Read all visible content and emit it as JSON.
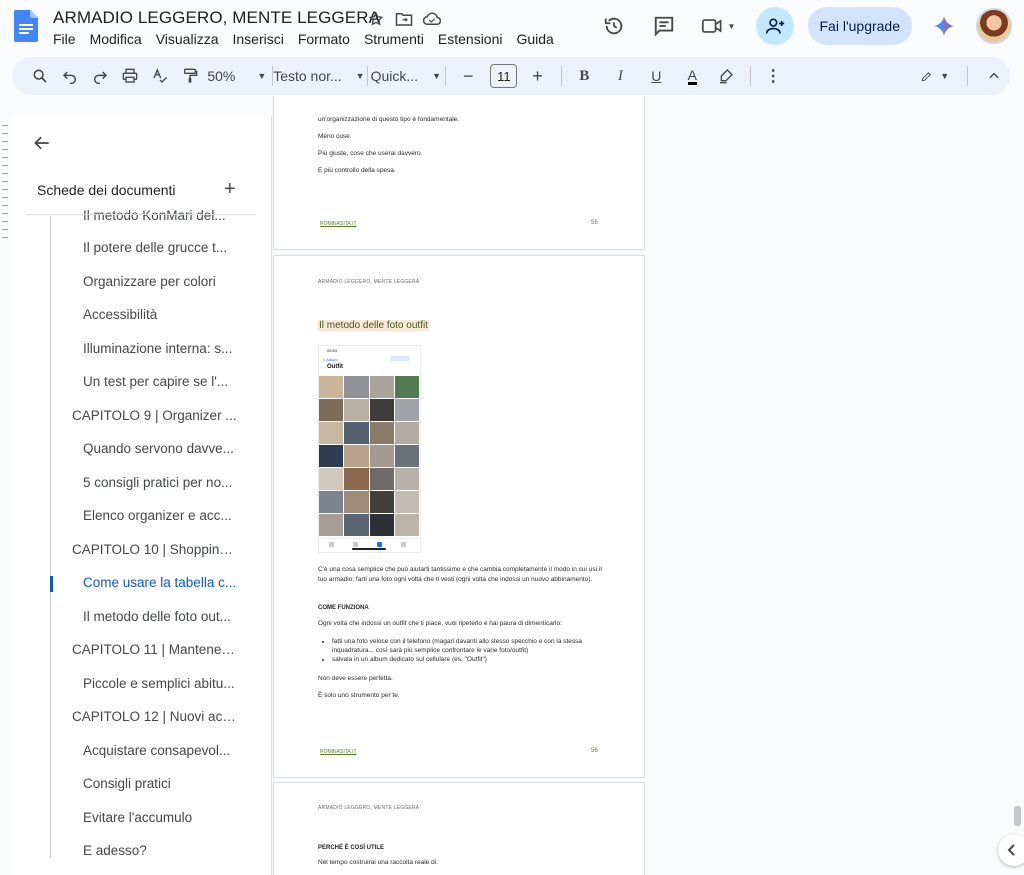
{
  "header": {
    "title": "ARMADIO LEGGERO, MENTE LEGGERA",
    "menu": [
      "File",
      "Modifica",
      "Visualizza",
      "Inserisci",
      "Formato",
      "Strumenti",
      "Estensioni",
      "Guida"
    ],
    "upgrade_label": "Fai l'upgrade"
  },
  "toolbar": {
    "zoom": "50%",
    "style": "Testo nor...",
    "font": "Quick...",
    "font_size": "11",
    "bold": "B",
    "italic": "I",
    "underline": "U",
    "text_color": "A"
  },
  "sidebar": {
    "title": "Schede dei documenti",
    "items": [
      {
        "label": "Il metodo KonMari del...",
        "level": 2,
        "active": false
      },
      {
        "label": "Il potere delle grucce t...",
        "level": 2,
        "active": false
      },
      {
        "label": "Organizzare per colori",
        "level": 2,
        "active": false
      },
      {
        "label": "Accessibilità",
        "level": 2,
        "active": false
      },
      {
        "label": "Illuminazione interna: s...",
        "level": 2,
        "active": false
      },
      {
        "label": "Un test per capire se l'...",
        "level": 2,
        "active": false
      },
      {
        "label": "CAPITOLO 9 | Organizer ...",
        "level": 1,
        "active": false
      },
      {
        "label": "Quando servono davve...",
        "level": 2,
        "active": false
      },
      {
        "label": "5 consigli pratici per no...",
        "level": 2,
        "active": false
      },
      {
        "label": "Elenco organizer e acc...",
        "level": 2,
        "active": false
      },
      {
        "label": "CAPITOLO 10 | Shopping ...",
        "level": 1,
        "active": false
      },
      {
        "label": "Come usare la tabella c...",
        "level": 2,
        "active": true
      },
      {
        "label": "Il metodo delle foto out...",
        "level": 2,
        "active": false
      },
      {
        "label": "CAPITOLO 11 | Mantenere...",
        "level": 1,
        "active": false
      },
      {
        "label": "Piccole e semplici abitu...",
        "level": 2,
        "active": false
      },
      {
        "label": "CAPITOLO 12 | Nuovi acq...",
        "level": 1,
        "active": false
      },
      {
        "label": "Acquistare consapevol...",
        "level": 2,
        "active": false
      },
      {
        "label": "Consigli pratici",
        "level": 2,
        "active": false
      },
      {
        "label": "Evitare l'accumulo",
        "level": 2,
        "active": false
      },
      {
        "label": "E adesso?",
        "level": 2,
        "active": false
      }
    ]
  },
  "pages": {
    "p55": {
      "line1": "un'organizzazione di questo tipo è fondamentale.",
      "line2": "Meno cose.",
      "line3": "Più giuste, cose che userai davvero.",
      "line4": "E più controllo della spesa.",
      "footer_link": "ROMINASITA.IT",
      "page_number": "55"
    },
    "p56": {
      "running_header": "ARMADIO LEGGERO, MENTE LEGGERA",
      "heading": "Il metodo delle foto outfit",
      "phone": {
        "time": "09:53",
        "back": "< Album",
        "title": "Outfit"
      },
      "para1": "C'è una cosa semplice che può aiutarti tantissimo e che cambia completamente il modo in cui usi il tuo armadio: farti una foto ogni volta che ti vesti (ogni volta che indossi un nuovo abbinamento).",
      "subheading": "COME FUNZIONA",
      "para2": "Ogni volta che indossi un outfit che ti piace, vuoi ripeterlo e hai paura di dimenticarlo:",
      "bullets": [
        "fatti una foto veloce con il telefono (magari davanti allo stesso specchio e con la stessa inquadratura... così sarà più semplice confrontare le varie foto/outfit)",
        "salvala in un album dedicato sul cellulare (es. \"Outfit\")"
      ],
      "para3": "Non deve essere perfetta.",
      "para4": "È solo uno strumento per te.",
      "footer_link": "ROMINASITA.IT",
      "page_number": "56"
    },
    "p57": {
      "running_header": "ARMADIO LEGGERO, MENTE LEGGERA",
      "subheading": "PERCHÉ È COSÌ UTILE",
      "para1": "Nel tempo costruirai una raccolta reale di:"
    }
  },
  "colors": {
    "accent": "#0b57d0",
    "heading_highlight": "#fce8d6",
    "footer_green": "#5b7a2a",
    "upgrade_bg": "#d3e3fd"
  }
}
